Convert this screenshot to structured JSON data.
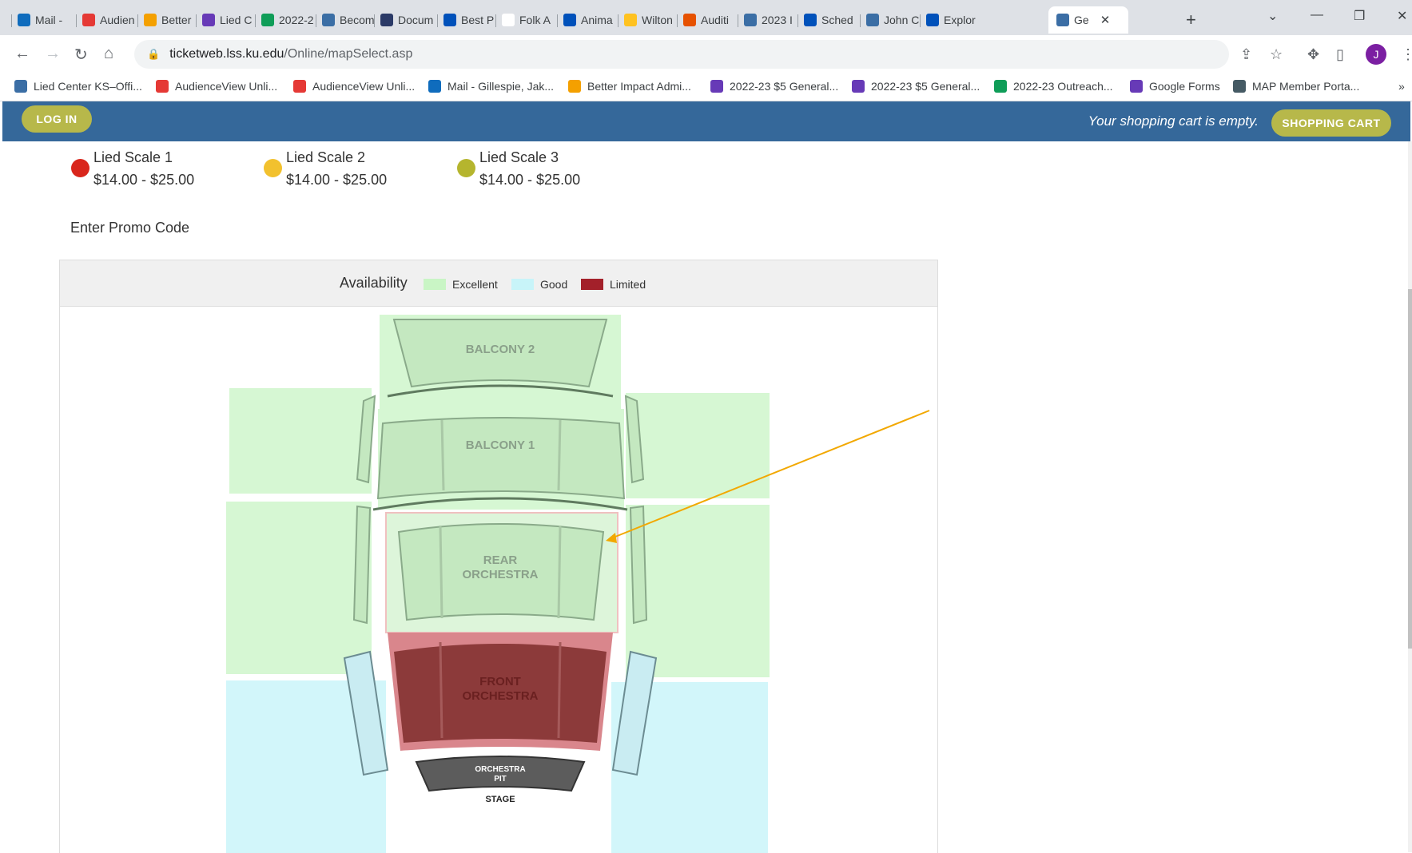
{
  "browser": {
    "tabs": [
      {
        "label": "Mail -",
        "icon": "outlook-icon",
        "color": "#0f6cbd"
      },
      {
        "label": "Audien",
        "icon": "audienceview-icon",
        "color": "#e53935"
      },
      {
        "label": "Better",
        "icon": "betterimpact-icon",
        "color": "#f4a000"
      },
      {
        "label": "Lied C",
        "icon": "forms-icon",
        "color": "#673ab7"
      },
      {
        "label": "2022-2",
        "icon": "sheets-icon",
        "color": "#0f9d58"
      },
      {
        "label": "Becom",
        "icon": "lied-icon",
        "color": "#3b6ea5"
      },
      {
        "label": "Docum",
        "icon": "docusign-icon",
        "color": "#2b3a67"
      },
      {
        "label": "Best P",
        "icon": "ku-icon",
        "color": "#0051ba"
      },
      {
        "label": "Folk A",
        "icon": "blank-icon",
        "color": "#ffffff"
      },
      {
        "label": "Anima",
        "icon": "ku-icon",
        "color": "#0051ba"
      },
      {
        "label": "Wilton",
        "icon": "walmart-icon",
        "color": "#ffc220"
      },
      {
        "label": "Auditi",
        "icon": "audition-icon",
        "color": "#e65100"
      },
      {
        "label": "2023 I",
        "icon": "lied-icon",
        "color": "#3b6ea5"
      },
      {
        "label": "Sched",
        "icon": "ku-icon",
        "color": "#0051ba"
      },
      {
        "label": "John C",
        "icon": "lied-icon",
        "color": "#3b6ea5"
      },
      {
        "label": "Explor",
        "icon": "ku-icon",
        "color": "#0051ba"
      }
    ],
    "active_tab": {
      "label": "Ge",
      "icon": "lied-icon",
      "color": "#3b6ea5"
    },
    "url_host": "ticketweb.lss.ku.edu",
    "url_path": "/Online/mapSelect.asp",
    "profile_initial": "J",
    "bookmarks": [
      {
        "label": "Lied Center KS–Offi...",
        "icon": "lied-icon",
        "color": "#3b6ea5"
      },
      {
        "label": "AudienceView Unli...",
        "icon": "audienceview-icon",
        "color": "#e53935"
      },
      {
        "label": "AudienceView Unli...",
        "icon": "audienceview-icon",
        "color": "#e53935"
      },
      {
        "label": "Mail - Gillespie, Jak...",
        "icon": "outlook-icon",
        "color": "#0f6cbd"
      },
      {
        "label": "Better Impact Admi...",
        "icon": "betterimpact-icon",
        "color": "#f4a000"
      },
      {
        "label": "2022-23 $5 General...",
        "icon": "forms-icon",
        "color": "#673ab7"
      },
      {
        "label": "2022-23 $5 General...",
        "icon": "forms-icon",
        "color": "#673ab7"
      },
      {
        "label": "2022-23 Outreach...",
        "icon": "sheets-icon",
        "color": "#0f9d58"
      },
      {
        "label": "Google Forms",
        "icon": "forms-icon",
        "color": "#673ab7"
      },
      {
        "label": "MAP Member Porta...",
        "icon": "shield-icon",
        "color": "#455a64"
      }
    ],
    "more_bookmarks": "»"
  },
  "site": {
    "login_label": "LOG IN",
    "cart_message": "Your shopping cart is empty.",
    "cart_button": "SHOPPING CART",
    "bar_color": "#35689a",
    "button_color": "#b7b84a"
  },
  "price_scales": [
    {
      "name": "Lied Scale 1",
      "price": "$14.00 - $25.00",
      "color": "#d9261c"
    },
    {
      "name": "Lied Scale 2",
      "price": "$14.00 - $25.00",
      "color": "#f2c12e"
    },
    {
      "name": "Lied Scale 3",
      "price": "$14.00 - $25.00",
      "color": "#b5b52e"
    }
  ],
  "promo_label": "Enter Promo Code",
  "availability": {
    "title": "Availability",
    "legend": [
      {
        "label": "Excellent",
        "color": "#c9f5c5"
      },
      {
        "label": "Good",
        "color": "#c8f4f9"
      },
      {
        "label": "Limited",
        "color": "#a3202a"
      }
    ]
  },
  "seating_map": {
    "sections": [
      {
        "name": "BALCONY 2",
        "availability": "Excellent"
      },
      {
        "name": "BALCONY 1",
        "availability": "Excellent"
      },
      {
        "name": "REAR ORCHESTRA",
        "availability": "Excellent"
      },
      {
        "name": "FRONT ORCHESTRA",
        "availability": "Limited"
      },
      {
        "name": "ORCHESTRA PIT",
        "availability": "Good"
      }
    ],
    "stage_label": "STAGE",
    "balcony2_label": "BALCONY 2",
    "balcony1_label": "BALCONY 1",
    "rear_line1": "REAR",
    "rear_line2": "ORCHESTRA",
    "front_line1": "FRONT",
    "front_line2": "ORCHESTRA",
    "pit_line1": "ORCHESTRA",
    "pit_line2": "PIT"
  }
}
